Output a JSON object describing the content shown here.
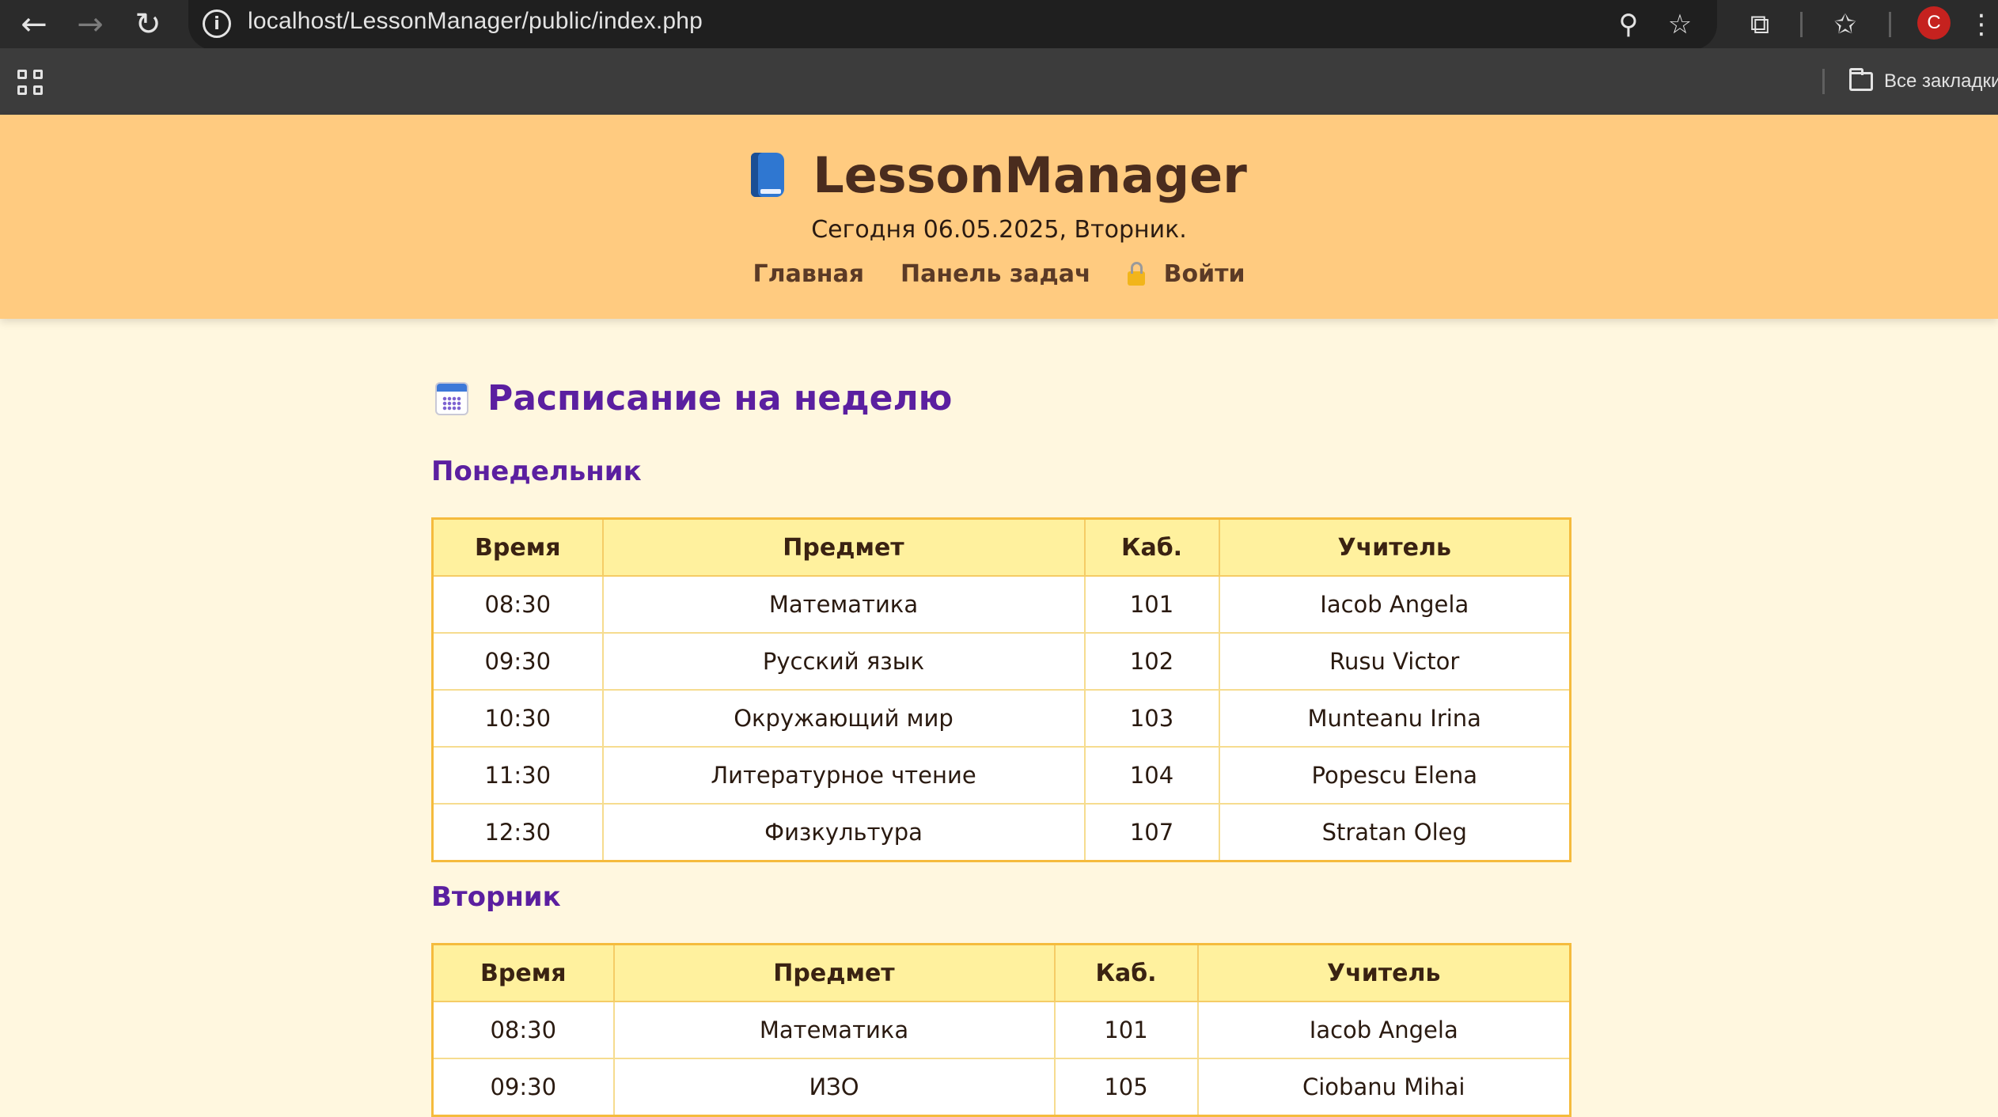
{
  "browser": {
    "url": "localhost/LessonManager/public/index.php",
    "profile_initial": "C",
    "bookmarks_label": "Все закладки"
  },
  "site": {
    "brand": "LessonManager",
    "today": "Сегодня 06.05.2025, Вторник.",
    "nav": {
      "home": "Главная",
      "tasks": "Панель задач",
      "login": "Войти"
    }
  },
  "schedule": {
    "title": "Расписание на неделю",
    "headers": [
      "Время",
      "Предмет",
      "Каб.",
      "Учитель"
    ],
    "days": [
      {
        "name": "Понедельник",
        "rows": [
          [
            "08:30",
            "Математика",
            "101",
            "Iacob Angela"
          ],
          [
            "09:30",
            "Русский язык",
            "102",
            "Rusu Victor"
          ],
          [
            "10:30",
            "Окружающий мир",
            "103",
            "Munteanu Irina"
          ],
          [
            "11:30",
            "Литературное чтение",
            "104",
            "Popescu Elena"
          ],
          [
            "12:30",
            "Физкультура",
            "107",
            "Stratan Oleg"
          ]
        ]
      },
      {
        "name": "Вторник",
        "rows": [
          [
            "08:30",
            "Математика",
            "101",
            "Iacob Angela"
          ],
          [
            "09:30",
            "ИЗО",
            "105",
            "Ciobanu Mihai"
          ]
        ]
      }
    ]
  },
  "colors": {
    "header_bg": "#ffcb80",
    "page_bg": "#fff7df",
    "accent_purple": "#5b1fa0",
    "table_border": "#f5bb3d",
    "table_head_bg": "#fff19e"
  }
}
